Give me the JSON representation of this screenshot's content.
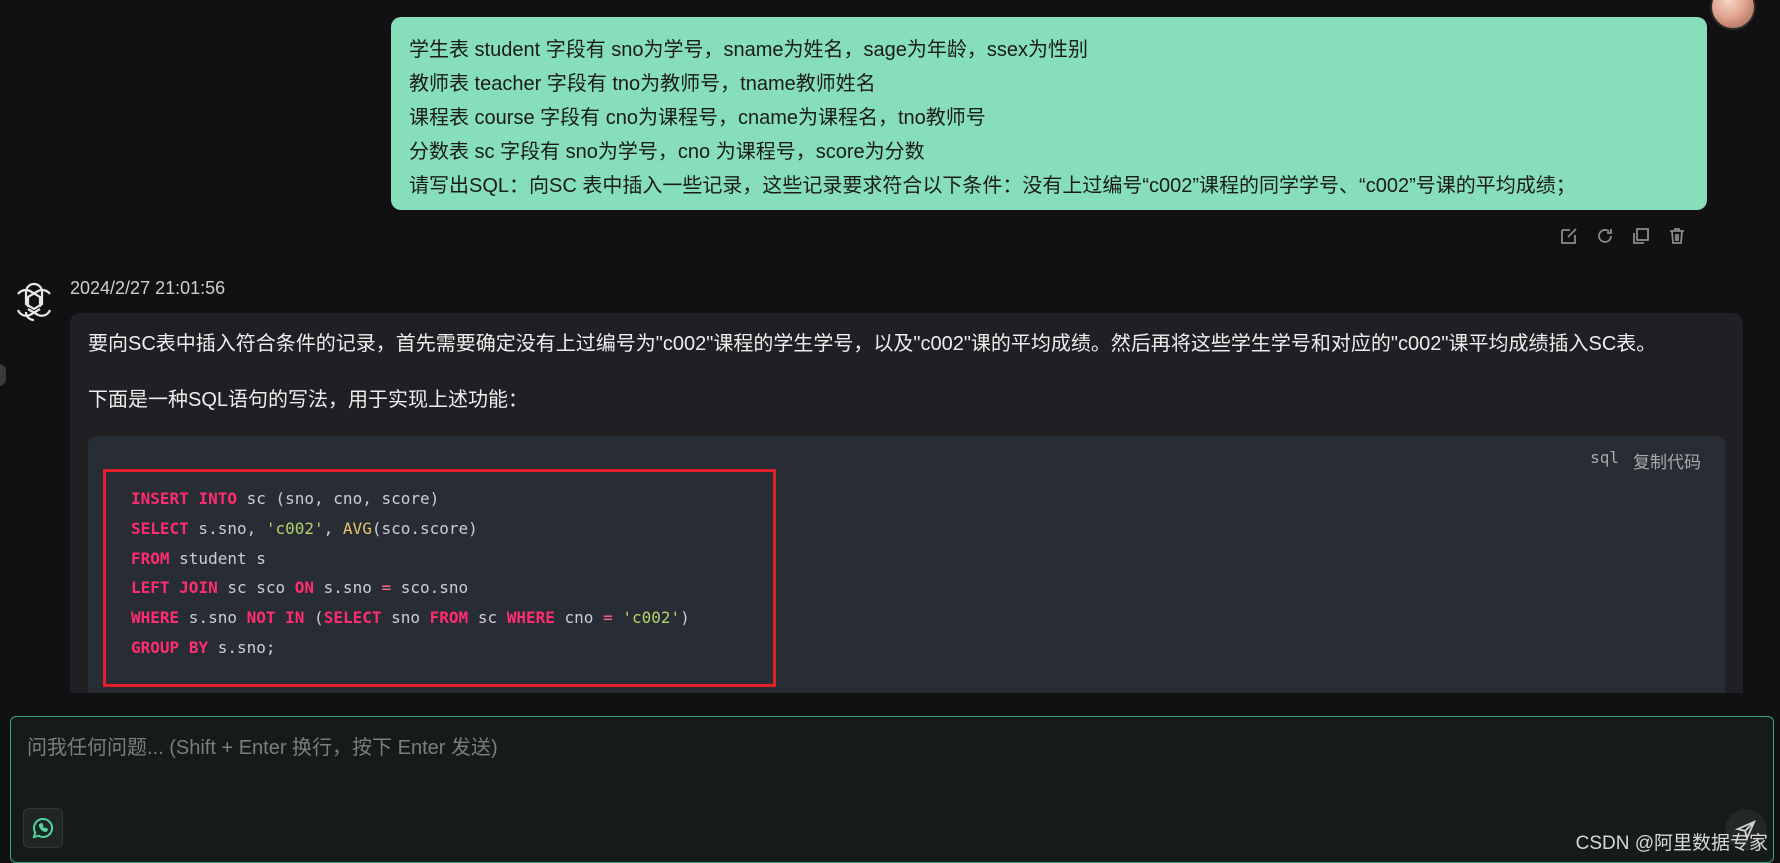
{
  "user_message": {
    "lines": [
      "学生表 student 字段有 sno为学号，sname为姓名，sage为年龄，ssex为性别",
      "教师表 teacher 字段有 tno为教师号，tname教师姓名",
      "课程表 course 字段有 cno为课程号，cname为课程名，tno教师号",
      "分数表 sc 字段有 sno为学号，cno 为课程号，score为分数",
      "请写出SQL：向SC 表中插入一些记录，这些记录要求符合以下条件：没有上过编号“c002”课程的同学学号、“c002”号课的平均成绩；"
    ],
    "actions": [
      "edit-icon",
      "refresh-icon",
      "copy-icon",
      "delete-icon"
    ]
  },
  "assistant_message": {
    "timestamp": "2024/2/27 21:01:56",
    "paragraphs": [
      "要向SC表中插入符合条件的记录，首先需要确定没有上过编号为\"c002\"课程的学生学号，以及\"c002\"课的平均成绩。然后再将这些学生学号和对应的\"c002\"课平均成绩插入SC表。",
      "下面是一种SQL语句的写法，用于实现上述功能："
    ],
    "code": {
      "language": "sql",
      "copy_label": "复制代码",
      "lines": [
        "INSERT INTO sc (sno, cno, score)",
        "SELECT s.sno, 'c002', AVG(sco.score)",
        "FROM student s",
        "LEFT JOIN sc sco ON s.sno = sco.sno",
        "WHERE s.sno NOT IN (SELECT sno FROM sc WHERE cno = 'c002')",
        "GROUP BY s.sno;"
      ]
    }
  },
  "input": {
    "placeholder": "问我任何问题... (Shift + Enter 换行，按下 Enter 发送)",
    "value": ""
  },
  "watermark": "CSDN @阿里数据专家",
  "colors": {
    "user_bubble": "#86dfba",
    "keyword": "#ff2d6f",
    "string": "#b4d36a",
    "highlight_box": "#e3202a",
    "input_border": "#3aa57a"
  }
}
